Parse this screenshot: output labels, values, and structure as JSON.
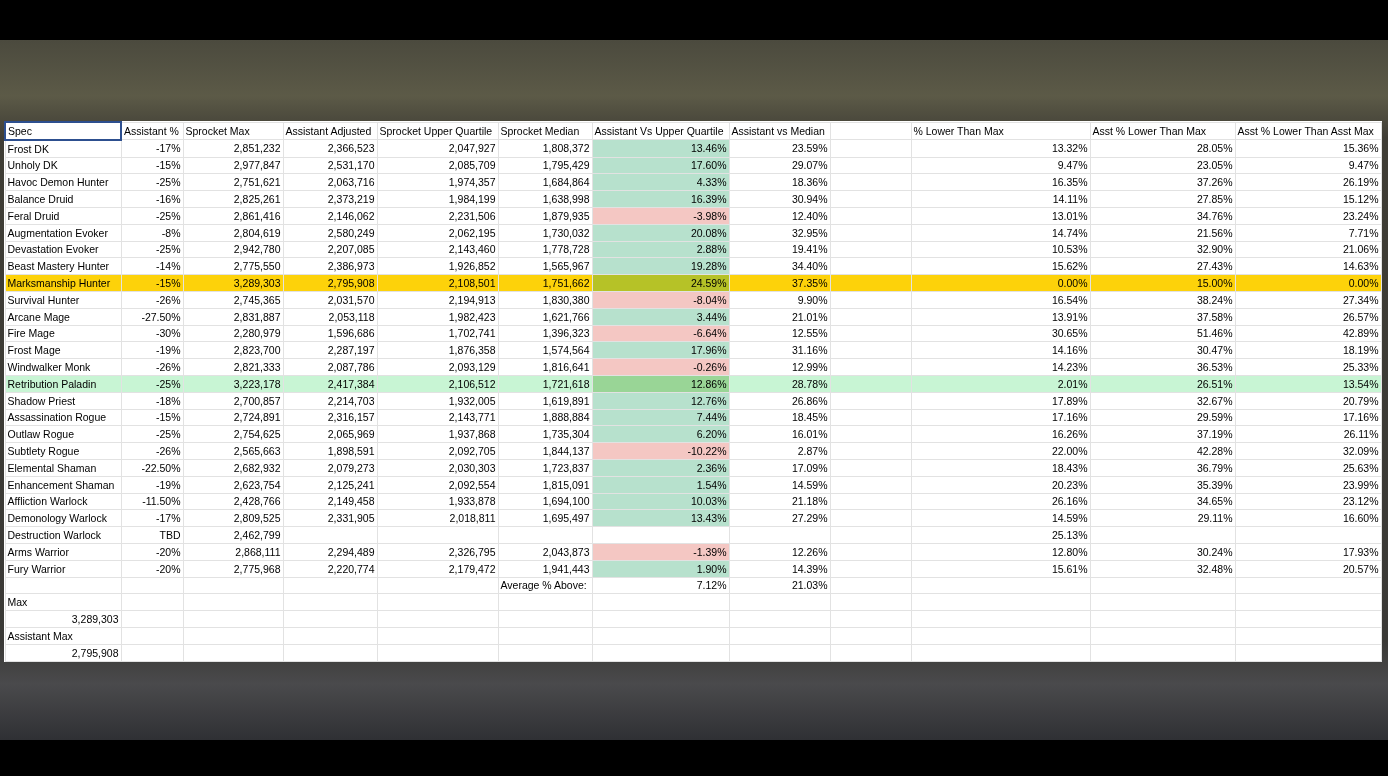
{
  "columns": [
    {
      "label": "Spec",
      "selected": true
    },
    {
      "label": "Assistant %",
      "selected": false
    },
    {
      "label": "Sprocket Max",
      "selected": false
    },
    {
      "label": "Assistant Adjusted",
      "selected": false
    },
    {
      "label": "Sprocket Upper Quartile",
      "selected": false
    },
    {
      "label": "Sprocket Median",
      "selected": false
    },
    {
      "label": "Assistant Vs Upper Quartile",
      "selected": false
    },
    {
      "label": "Assistant vs Median",
      "selected": false
    },
    {
      "selected": false
    },
    {
      "label": "% Lower Than Max",
      "selected": false
    },
    {
      "label": "Asst % Lower Than Max",
      "selected": false
    },
    {
      "label": "Asst % Lower Than Asst Max",
      "selected": false
    }
  ],
  "rows": [
    {
      "kind": "data",
      "above_quartile": true,
      "cells": [
        "Frost DK",
        "-17%",
        "2,851,232",
        "2,366,523",
        "2,047,927",
        "1,808,372",
        "13.46%",
        "23.59%",
        null,
        "13.32%",
        "28.05%",
        "15.36%"
      ]
    },
    {
      "kind": "data",
      "above_quartile": true,
      "cells": [
        "Unholy DK",
        "-15%",
        "2,977,847",
        "2,531,170",
        "2,085,709",
        "1,795,429",
        "17.60%",
        "29.07%",
        null,
        "9.47%",
        "23.05%",
        "9.47%"
      ]
    },
    {
      "kind": "data",
      "above_quartile": true,
      "cells": [
        "Havoc Demon Hunter",
        "-25%",
        "2,751,621",
        "2,063,716",
        "1,974,357",
        "1,684,864",
        "4.33%",
        "18.36%",
        null,
        "16.35%",
        "37.26%",
        "26.19%"
      ]
    },
    {
      "kind": "data",
      "above_quartile": true,
      "cells": [
        "Balance Druid",
        "-16%",
        "2,825,261",
        "2,373,219",
        "1,984,199",
        "1,638,998",
        "16.39%",
        "30.94%",
        null,
        "14.11%",
        "27.85%",
        "15.12%"
      ]
    },
    {
      "kind": "data",
      "above_quartile": false,
      "cells": [
        "Feral Druid",
        "-25%",
        "2,861,416",
        "2,146,062",
        "2,231,506",
        "1,879,935",
        "-3.98%",
        "12.40%",
        null,
        "13.01%",
        "34.76%",
        "23.24%"
      ]
    },
    {
      "kind": "data",
      "above_quartile": true,
      "cells": [
        "Augmentation Evoker",
        "-8%",
        "2,804,619",
        "2,580,249",
        "2,062,195",
        "1,730,032",
        "20.08%",
        "32.95%",
        null,
        "14.74%",
        "21.56%",
        "7.71%"
      ]
    },
    {
      "kind": "data",
      "above_quartile": true,
      "cells": [
        "Devastation Evoker",
        "-25%",
        "2,942,780",
        "2,207,085",
        "2,143,460",
        "1,778,728",
        "2.88%",
        "19.41%",
        null,
        "10.53%",
        "32.90%",
        "21.06%"
      ]
    },
    {
      "kind": "data",
      "above_quartile": true,
      "cells": [
        "Beast Mastery Hunter",
        "-14%",
        "2,775,550",
        "2,386,973",
        "1,926,852",
        "1,565,967",
        "19.28%",
        "34.40%",
        null,
        "15.62%",
        "27.43%",
        "14.63%"
      ]
    },
    {
      "kind": "data",
      "above_quartile": true,
      "color": "#fdd20a",
      "cells": [
        "Marksmanship Hunter",
        "-15%",
        "3,289,303",
        "2,795,908",
        "2,108,501",
        "1,751,662",
        "24.59%",
        "37.35%",
        null,
        "0.00%",
        "15.00%",
        "0.00%"
      ]
    },
    {
      "kind": "data",
      "above_quartile": false,
      "cells": [
        "Survival Hunter",
        "-26%",
        "2,745,365",
        "2,031,570",
        "2,194,913",
        "1,830,380",
        "-8.04%",
        "9.90%",
        null,
        "16.54%",
        "38.24%",
        "27.34%"
      ]
    },
    {
      "kind": "data",
      "above_quartile": true,
      "cells": [
        "Arcane Mage",
        "-27.50%",
        "2,831,887",
        "2,053,118",
        "1,982,423",
        "1,621,766",
        "3.44%",
        "21.01%",
        null,
        "13.91%",
        "37.58%",
        "26.57%"
      ]
    },
    {
      "kind": "data",
      "above_quartile": false,
      "cells": [
        "Fire Mage",
        "-30%",
        "2,280,979",
        "1,596,686",
        "1,702,741",
        "1,396,323",
        "-6.64%",
        "12.55%",
        null,
        "30.65%",
        "51.46%",
        "42.89%"
      ]
    },
    {
      "kind": "data",
      "above_quartile": true,
      "cells": [
        "Frost Mage",
        "-19%",
        "2,823,700",
        "2,287,197",
        "1,876,358",
        "1,574,564",
        "17.96%",
        "31.16%",
        null,
        "14.16%",
        "30.47%",
        "18.19%"
      ]
    },
    {
      "kind": "data",
      "above_quartile": false,
      "cells": [
        "Windwalker Monk",
        "-26%",
        "2,821,333",
        "2,087,786",
        "2,093,129",
        "1,816,641",
        "-0.26%",
        "12.99%",
        null,
        "14.23%",
        "36.53%",
        "25.33%"
      ]
    },
    {
      "kind": "data",
      "above_quartile": true,
      "color": "#c8f5d4",
      "cells": [
        "Retribution Paladin",
        "-25%",
        "3,223,178",
        "2,417,384",
        "2,106,512",
        "1,721,618",
        "12.86%",
        "28.78%",
        null,
        "2.01%",
        "26.51%",
        "13.54%"
      ]
    },
    {
      "kind": "data",
      "above_quartile": true,
      "cells": [
        "Shadow Priest",
        "-18%",
        "2,700,857",
        "2,214,703",
        "1,932,005",
        "1,619,891",
        "12.76%",
        "26.86%",
        null,
        "17.89%",
        "32.67%",
        "20.79%"
      ]
    },
    {
      "kind": "data",
      "above_quartile": true,
      "cells": [
        "Assassination Rogue",
        "-15%",
        "2,724,891",
        "2,316,157",
        "2,143,771",
        "1,888,884",
        "7.44%",
        "18.45%",
        null,
        "17.16%",
        "29.59%",
        "17.16%"
      ]
    },
    {
      "kind": "data",
      "above_quartile": true,
      "cells": [
        "Outlaw Rogue",
        "-25%",
        "2,754,625",
        "2,065,969",
        "1,937,868",
        "1,735,304",
        "6.20%",
        "16.01%",
        null,
        "16.26%",
        "37.19%",
        "26.11%"
      ]
    },
    {
      "kind": "data",
      "above_quartile": false,
      "cells": [
        "Subtlety Rogue",
        "-26%",
        "2,565,663",
        "1,898,591",
        "2,092,705",
        "1,844,137",
        "-10.22%",
        "2.87%",
        null,
        "22.00%",
        "42.28%",
        "32.09%"
      ]
    },
    {
      "kind": "data",
      "above_quartile": true,
      "cells": [
        "Elemental Shaman",
        "-22.50%",
        "2,682,932",
        "2,079,273",
        "2,030,303",
        "1,723,837",
        "2.36%",
        "17.09%",
        null,
        "18.43%",
        "36.79%",
        "25.63%"
      ]
    },
    {
      "kind": "data",
      "above_quartile": true,
      "cells": [
        "Enhancement Shaman",
        "-19%",
        "2,623,754",
        "2,125,241",
        "2,092,554",
        "1,815,091",
        "1.54%",
        "14.59%",
        null,
        "20.23%",
        "35.39%",
        "23.99%"
      ]
    },
    {
      "kind": "data",
      "above_quartile": true,
      "cells": [
        "Affliction Warlock",
        "-11.50%",
        "2,428,766",
        "2,149,458",
        "1,933,878",
        "1,694,100",
        "10.03%",
        "21.18%",
        null,
        "26.16%",
        "34.65%",
        "23.12%"
      ]
    },
    {
      "kind": "data",
      "above_quartile": true,
      "cells": [
        "Demonology Warlock",
        "-17%",
        "2,809,525",
        "2,331,905",
        "2,018,811",
        "1,695,497",
        "13.43%",
        "27.29%",
        null,
        "14.59%",
        "29.11%",
        "16.60%"
      ]
    },
    {
      "kind": "data",
      "cells": [
        "Destruction Warlock",
        "TBD",
        "2,462,799",
        null,
        null,
        null,
        null,
        null,
        null,
        "25.13%",
        null,
        null
      ]
    },
    {
      "kind": "data",
      "above_quartile": false,
      "cells": [
        "Arms Warrior",
        "-20%",
        "2,868,111",
        "2,294,489",
        "2,326,795",
        "2,043,873",
        "-1.39%",
        "12.26%",
        null,
        "12.80%",
        "30.24%",
        "17.93%"
      ]
    },
    {
      "kind": "data",
      "above_quartile": true,
      "cells": [
        "Fury Warrior",
        "-20%",
        "2,775,968",
        "2,220,774",
        "2,179,472",
        "1,941,443",
        "1.90%",
        "14.39%",
        null,
        "15.61%",
        "32.48%",
        "20.57%"
      ]
    },
    {
      "kind": "average",
      "cells": [
        null,
        null,
        null,
        null,
        null,
        "Average % Above:",
        "7.12%",
        "21.03%",
        null,
        null,
        null,
        null
      ]
    },
    {
      "kind": "label",
      "cells": [
        "Max"
      ]
    },
    {
      "kind": "value",
      "cells": [
        "3,289,303"
      ]
    },
    {
      "kind": "label",
      "cells": [
        "Assistant Max"
      ]
    },
    {
      "kind": "value",
      "cells": [
        "2,795,908"
      ]
    }
  ]
}
